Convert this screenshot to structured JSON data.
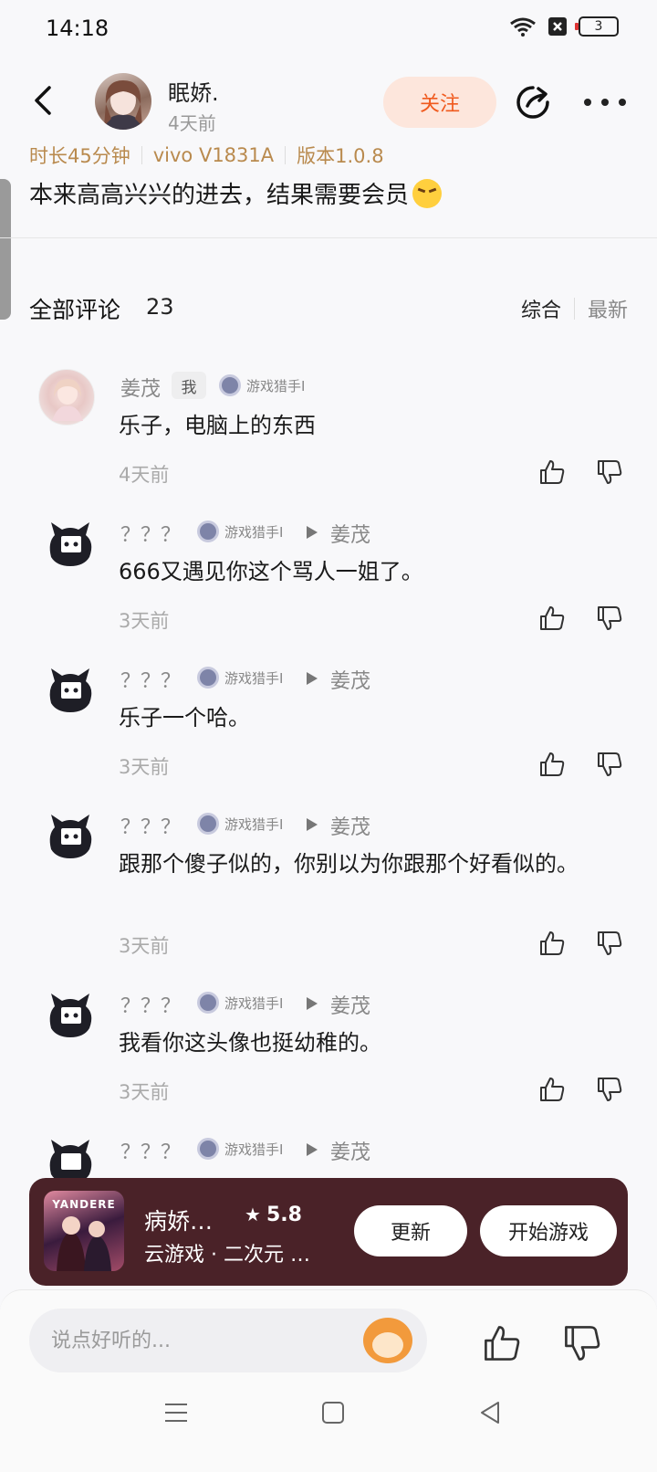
{
  "status": {
    "time": "14:18",
    "battery": "3"
  },
  "post": {
    "author": "眠娇.",
    "time": "4天前",
    "follow_label": "关注",
    "meta": [
      "时长45分钟",
      "vivo V1831A",
      "版本1.0.8"
    ],
    "text": "本来高高兴兴的进去，结果需要会员"
  },
  "comments_header": {
    "title": "全部评论",
    "count": "23",
    "sort_options": [
      "综合",
      "最新"
    ]
  },
  "comments": [
    {
      "name": "姜茂",
      "tag": "我",
      "badge": "游戏猎手I",
      "reply_to": "",
      "text": "乐子，电脑上的东西",
      "time": "4天前"
    },
    {
      "name": "？？？",
      "tag": "",
      "badge": "游戏猎手I",
      "reply_to": "姜茂",
      "text": "666又遇见你这个骂人一姐了。",
      "time": "3天前"
    },
    {
      "name": "？？？",
      "tag": "",
      "badge": "游戏猎手I",
      "reply_to": "姜茂",
      "text": "乐子一个哈。",
      "time": "3天前"
    },
    {
      "name": "？？？",
      "tag": "",
      "badge": "游戏猎手I",
      "reply_to": "姜茂",
      "text": "跟那个傻子似的，你别以为你跟那个好看似的。",
      "time": "3天前"
    },
    {
      "name": "？？？",
      "tag": "",
      "badge": "游戏猎手I",
      "reply_to": "姜茂",
      "text": "我看你这头像也挺幼稚的。",
      "time": "3天前"
    },
    {
      "name": "？？？",
      "tag": "",
      "badge": "游戏猎手I",
      "reply_to": "姜茂",
      "text": "",
      "time": ""
    }
  ],
  "game": {
    "thumb_text": "YANDERE",
    "name": "病娇…",
    "rating": "5.8",
    "subtitle": "云游戏 · 二次元 …",
    "update_label": "更新",
    "play_label": "开始游戏"
  },
  "comment_bar": {
    "placeholder": "说点好听的..."
  },
  "colors": {
    "accent_orange": "#f05a1e",
    "follow_bg": "#fde6dc",
    "meta_gold": "#b98a4e",
    "banner_bg": "#4a2228"
  }
}
